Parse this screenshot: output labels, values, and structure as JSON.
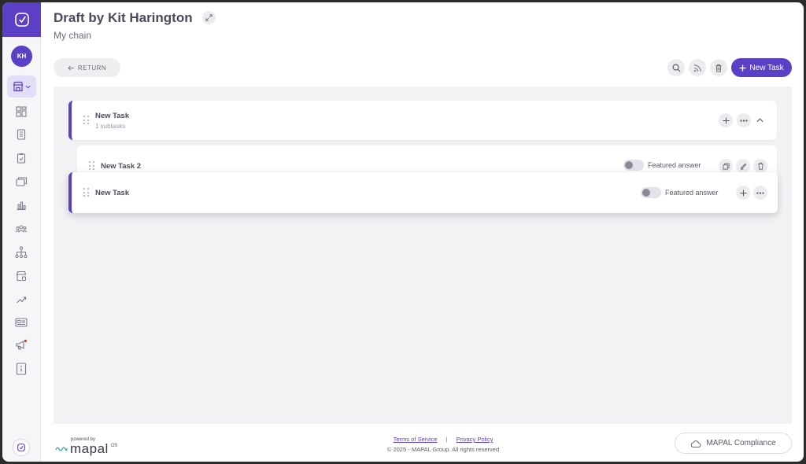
{
  "sidebar": {
    "avatar_initials": "KH",
    "brand_color": "#5b3fc4",
    "notification_dot_color": "#e0342c",
    "icons": [
      "dashboard-icon",
      "notebook-icon",
      "clipboard-check-icon",
      "gallery-icon",
      "bar-chart-icon",
      "team-icon",
      "org-chart-icon",
      "store-settings-icon",
      "trend-up-icon",
      "news-icon",
      "megaphone-icon",
      "info-icon"
    ]
  },
  "header": {
    "title": "Draft by Kit Harington",
    "subtitle": "My chain",
    "return_label": "RETURN",
    "new_task_label": "New Task"
  },
  "tasks": {
    "parent": {
      "name": "New Task",
      "subtasks": "1 subtasks"
    },
    "child": {
      "name": "New Task 2",
      "featured_label": "Featured answer"
    },
    "dragging": {
      "name": "New Task",
      "featured_label": "Featured answer"
    }
  },
  "footer": {
    "powered_by": "powered by",
    "brand": "mapal",
    "brand_suffix": "OS",
    "terms_label": "Terms of Service",
    "separator": "|",
    "privacy_label": "Privacy Policy",
    "copyright": "© 2025 - MAPAL Group. All rights reserved",
    "compliance_label": "MAPAL Compliance"
  }
}
